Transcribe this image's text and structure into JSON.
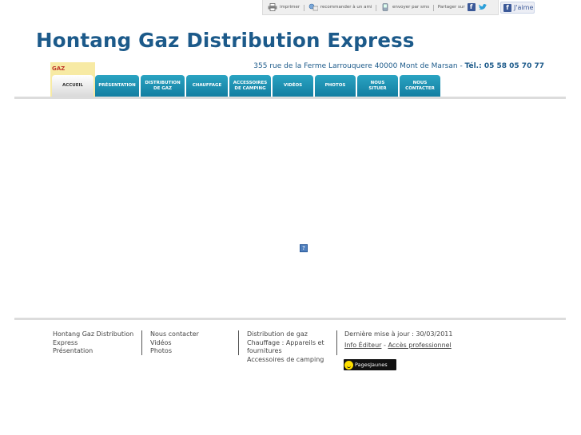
{
  "toolbar": {
    "print": "imprimer",
    "recommend": "recommander à un ami",
    "sms": "envoyer par sms",
    "share": "Partager sur",
    "like": "J'aime"
  },
  "header": {
    "title": "Hontang Gaz Distribution Express",
    "address": "355 rue de la Ferme Larrouquere 40000 Mont de Marsan",
    "tel_label": "Tél.: 05 58 05 70 77",
    "logo_text": "GAZ"
  },
  "nav": [
    {
      "line1": "Accueil",
      "line2": ""
    },
    {
      "line1": "Présentation",
      "line2": ""
    },
    {
      "line1": "Distribution",
      "line2": "de gaz"
    },
    {
      "line1": "Chauffage",
      "line2": ""
    },
    {
      "line1": "Accessoires",
      "line2": "de camping"
    },
    {
      "line1": "Vidéos",
      "line2": ""
    },
    {
      "line1": "Photos",
      "line2": ""
    },
    {
      "line1": "Nous",
      "line2": "situer"
    },
    {
      "line1": "Nous",
      "line2": "contacter"
    }
  ],
  "content": {
    "placeholder_icon": "?"
  },
  "footer": {
    "col1": [
      "Hontang Gaz Distribution",
      "Express",
      "Présentation"
    ],
    "col2": [
      "Nous contacter",
      "Vidéos",
      "Photos"
    ],
    "col3": [
      "Distribution de gaz",
      "Chauffage : Appareils et",
      "fournitures",
      "Accessoires de camping"
    ],
    "updated": "Dernière mise à jour : 30/03/2011",
    "info_editeur": "Info Éditeur",
    "acces_pro": "Accès professionnel",
    "pages_jaunes": "PagesJaunes"
  }
}
